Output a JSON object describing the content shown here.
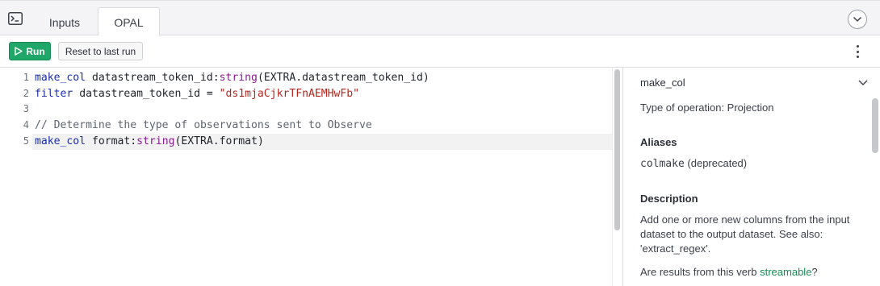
{
  "tabs": {
    "terminal_icon": "terminal-icon",
    "inputs_label": "Inputs",
    "opal_label": "OPAL",
    "collapse_icon": "chevron-down-icon"
  },
  "toolbar": {
    "run_label": "Run",
    "reset_label": "Reset to last run",
    "more_icon": "vertical-ellipsis-icon",
    "run_color": "#1fa669"
  },
  "editor": {
    "line_numbers": [
      "1",
      "2",
      "3",
      "4",
      "5"
    ],
    "lines": {
      "l1": {
        "kw": "make_col",
        "a": " datastream_token_id:",
        "ty": "string",
        "b": "(EXTRA.datastream_token_id)"
      },
      "l2": {
        "kw": "filter",
        "a": " datastream_token_id = ",
        "str": "\"ds1mjaCjkrTFnAEMHwFb\""
      },
      "l3": "",
      "l4": {
        "cmt": "// Determine the type of observations sent to Observe"
      },
      "l5": {
        "kw": "make_col",
        "a": " format:",
        "ty": "string",
        "b": "(EXTRA.format)"
      }
    }
  },
  "docs": {
    "verb": "make_col",
    "operation_type": "Type of operation: Projection",
    "aliases_title": "Aliases",
    "alias_code": "colmake",
    "alias_note": " (deprecated)",
    "description_title": "Description",
    "description_text": "Add one or more new columns from the input dataset to the output dataset. See also: 'extract_regex'.",
    "streamable_question_pre": "Are results from this verb ",
    "streamable_link": "streamable",
    "streamable_question_post": "?",
    "streamable_link_color": "#1a8a55"
  }
}
